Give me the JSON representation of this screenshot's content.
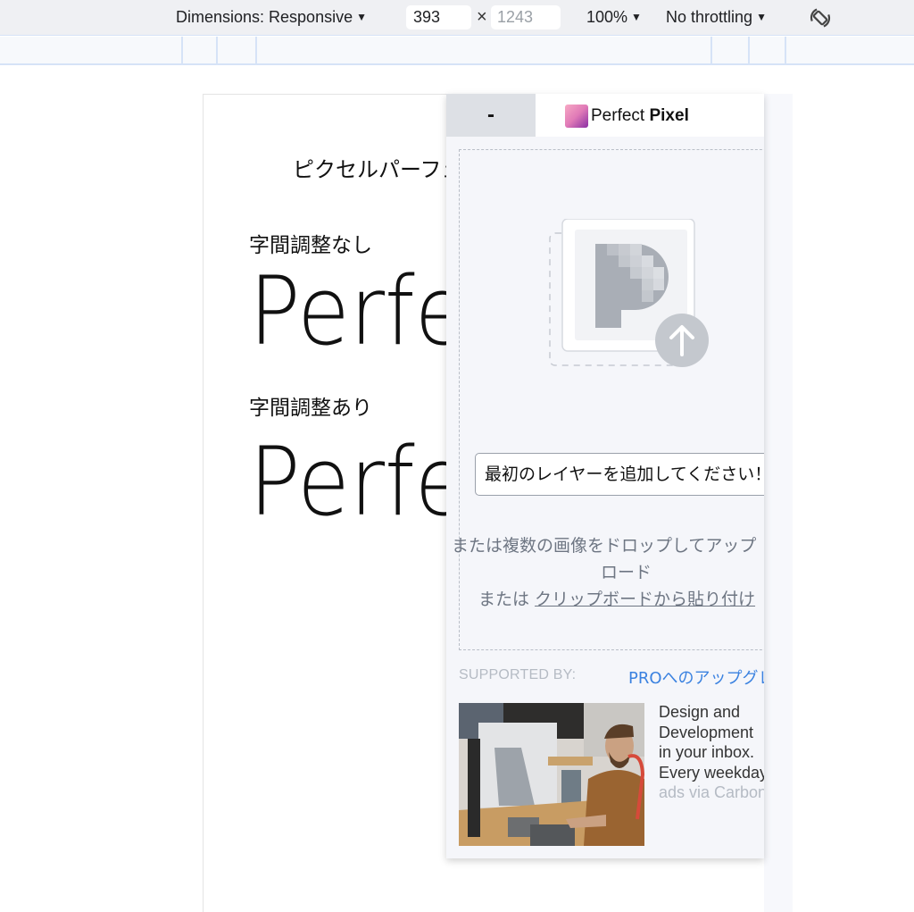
{
  "devtools": {
    "dimensions_label": "Dimensions: Responsive",
    "width_value": "393",
    "times": "×",
    "height_value": "1243",
    "zoom": "100%",
    "throttling": "No throttling",
    "caret": "▼"
  },
  "page": {
    "heading": "ピクセルパーフェクト",
    "label_no_kerning": "字間調整なし",
    "big_text_a": "Perfect Pixel",
    "label_with_kerning": "字間調整あり",
    "big_text_b": "Perfect Pixel"
  },
  "perfect_pixel": {
    "minimize_label": "-",
    "title_regular": "Perfect ",
    "title_bold": "Pixel",
    "add_layer_button": "最初のレイヤーを追加してください！",
    "drop_line1": "または複数の画像をドロップしてアップ",
    "drop_line2": "ロード",
    "drop_line3_prefix": "または ",
    "drop_line3_link": "クリップボードから貼り付け",
    "supported_by": "SUPPORTED BY:",
    "upgrade_link": "PROへのアップグレード",
    "ad_lines": [
      "Design and",
      "Development",
      "in your inbox.",
      "Every weekday"
    ],
    "ad_via": "ads via Carbon"
  }
}
